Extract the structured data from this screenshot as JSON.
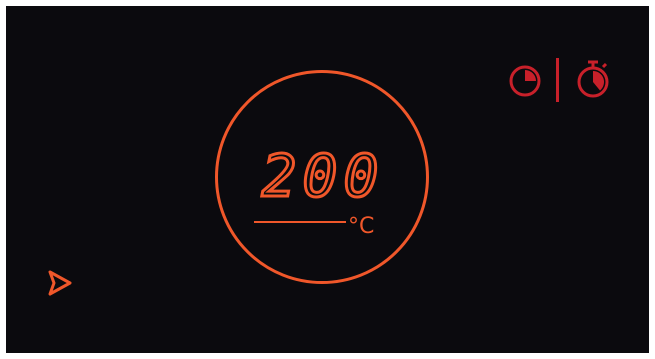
{
  "display": {
    "temperature": "200",
    "unit": "°C"
  },
  "icons": {
    "timer": "timer-icon",
    "stopwatch": "stopwatch-icon",
    "play": "play-icon"
  },
  "colors": {
    "accent": "#f0572a",
    "secondary": "#c8202a",
    "background": "#0b0a0e"
  }
}
